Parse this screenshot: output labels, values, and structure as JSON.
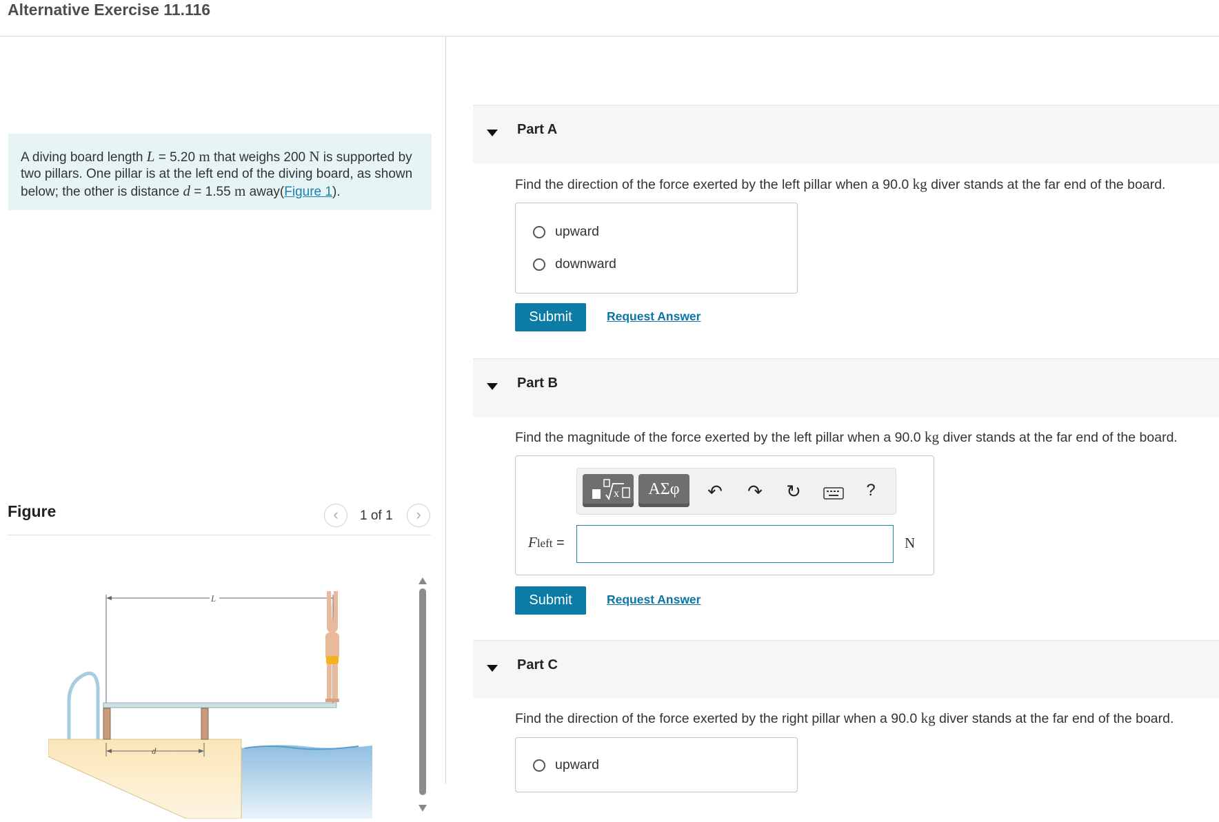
{
  "header": {
    "title": "Alternative Exercise 11.116"
  },
  "problem": {
    "t1": "A diving board length ",
    "v1": "L",
    "t2": " = 5.20 ",
    "u1": "m",
    "t3": " that weighs 200 ",
    "u2": "N",
    "t4": " is supported by two pillars. One pillar is at the left end of the diving board, as shown below; the other is distance ",
    "v2": "d",
    "t5": " = 1.55 ",
    "u3": "m",
    "t6": " away(",
    "link": "Figure 1",
    "t7": ")."
  },
  "figure_panel": {
    "label": "Figure",
    "pager": "1 of 1",
    "prev_icon": "chevron-left-icon",
    "next_icon": "chevron-right-icon",
    "dim_L": "L",
    "dim_d": "d"
  },
  "parts": {
    "a": {
      "label": "Part A",
      "q1": "Find the direction of the force exerted by the left pillar when a 90.0 ",
      "qu": "kg",
      "q2": " diver stands at the far end of the board.",
      "options": [
        "upward",
        "downward"
      ],
      "submit": "Submit",
      "request": "Request Answer"
    },
    "b": {
      "label": "Part B",
      "q1": "Find the magnitude of the force exerted by the left pillar when a 90.0 ",
      "qu": "kg",
      "q2": " diver stands at the far end of the board.",
      "var": "F",
      "var_sub": "left",
      "equals": "=",
      "unit": "N",
      "input_value": "",
      "greek": "ΑΣφ",
      "help": "?",
      "toolbar_icons": [
        "templates-icon",
        "greek-icon",
        "undo-icon",
        "redo-icon",
        "reset-icon",
        "keyboard-icon",
        "help-icon"
      ],
      "submit": "Submit",
      "request": "Request Answer"
    },
    "c": {
      "label": "Part C",
      "q1": "Find the direction of the force exerted by the right pillar when a 90.0 ",
      "qu": "kg",
      "q2": " diver stands at the far end of the board.",
      "options": [
        "upward"
      ]
    }
  },
  "colors": {
    "accent": "#0c7ba5",
    "problem_bg": "#e6f4f5",
    "part_header_bg": "#f6f6f6"
  }
}
